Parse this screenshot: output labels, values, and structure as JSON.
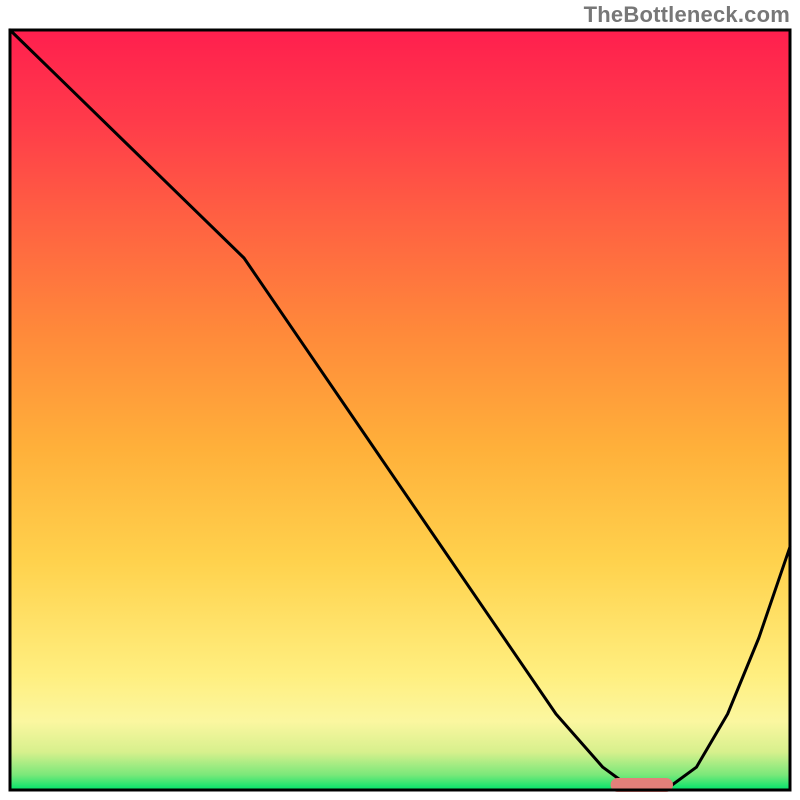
{
  "watermark": "TheBottleneck.com",
  "chart_data": {
    "type": "line",
    "title": "",
    "xlabel": "",
    "ylabel": "",
    "xlim": [
      0,
      100
    ],
    "ylim": [
      0,
      100
    ],
    "series": [
      {
        "name": "curve",
        "x": [
          0,
          6,
          12,
          18,
          24,
          30,
          38,
          46,
          54,
          62,
          70,
          76,
          80,
          84,
          88,
          92,
          96,
          100
        ],
        "y": [
          100,
          94,
          88,
          82,
          76,
          70,
          58,
          46,
          34,
          22,
          10,
          3,
          0,
          0,
          3,
          10,
          20,
          32
        ]
      }
    ],
    "optimal_marker": {
      "x_start": 77,
      "x_end": 85,
      "y": 0,
      "color": "#e3807a"
    },
    "gradient_stops": [
      {
        "offset": 0.0,
        "color": "#00e36b"
      },
      {
        "offset": 0.02,
        "color": "#7be87a"
      },
      {
        "offset": 0.05,
        "color": "#d7f08d"
      },
      {
        "offset": 0.09,
        "color": "#fbf7a0"
      },
      {
        "offset": 0.15,
        "color": "#ffef80"
      },
      {
        "offset": 0.3,
        "color": "#ffd24d"
      },
      {
        "offset": 0.45,
        "color": "#ffb03a"
      },
      {
        "offset": 0.6,
        "color": "#ff8a3a"
      },
      {
        "offset": 0.75,
        "color": "#ff6142"
      },
      {
        "offset": 0.88,
        "color": "#ff3b4a"
      },
      {
        "offset": 1.0,
        "color": "#ff1f4e"
      }
    ],
    "frame": {
      "stroke": "#000000",
      "stroke_width": 3
    }
  }
}
